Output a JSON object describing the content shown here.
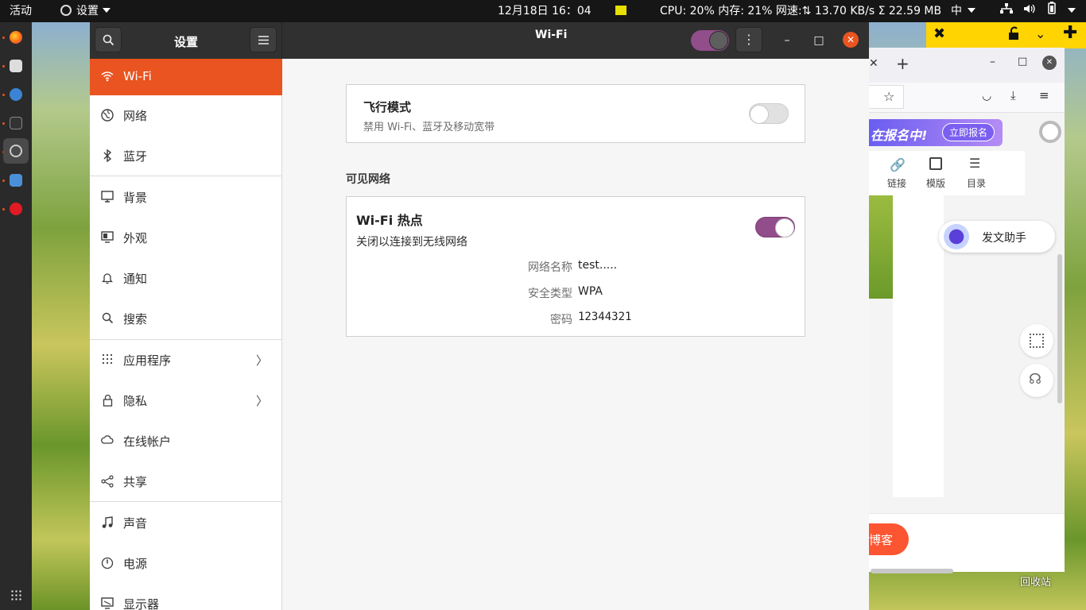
{
  "topbar": {
    "activities": "活动",
    "app_menu": "设置",
    "clock": "12月18日  16：04",
    "sysmon": "CPU: 20% 内存: 21% 网速:⇅ 13.70 KB/s Σ 22.59 MB",
    "input_method": "中"
  },
  "window": {
    "sidebar_title": "设置",
    "page_title": "Wi-Fi",
    "minimize_glyph": "–",
    "maximize_glyph": "□",
    "close_glyph": "✕",
    "menu_glyph": "⋮"
  },
  "sidebar": {
    "items": [
      {
        "label": "Wi-Fi",
        "icon": "wifi-icon"
      },
      {
        "label": "网络",
        "icon": "globe-icon"
      },
      {
        "label": "蓝牙",
        "icon": "bluetooth-icon"
      },
      {
        "label": "背景",
        "icon": "monitor-icon"
      },
      {
        "label": "外观",
        "icon": "appearance-icon"
      },
      {
        "label": "通知",
        "icon": "bell-icon"
      },
      {
        "label": "搜索",
        "icon": "search-icon"
      },
      {
        "label": "应用程序",
        "icon": "grid-icon"
      },
      {
        "label": "隐私",
        "icon": "lock-icon"
      },
      {
        "label": "在线帐户",
        "icon": "cloud-icon"
      },
      {
        "label": "共享",
        "icon": "share-icon"
      },
      {
        "label": "声音",
        "icon": "music-icon"
      },
      {
        "label": "电源",
        "icon": "power-icon"
      },
      {
        "label": "显示器",
        "icon": "display-icon"
      }
    ]
  },
  "airplane": {
    "title": "飞行模式",
    "subtitle": "禁用 Wi-Fi、蓝牙及移动宽带",
    "enabled": false
  },
  "visible_networks_label": "可见网络",
  "hotspot": {
    "title": "Wi-Fi 热点",
    "subtitle": "关闭以连接到无线网络",
    "enabled": true,
    "ssid_label": "网络名称",
    "ssid_value": "test.....",
    "security_label": "安全类型",
    "security_value": "WPA",
    "password_label": "密码",
    "password_value": "12344321"
  },
  "browser": {
    "banner_text": "在报名中!",
    "banner_button": "立即报名",
    "tool_link": "链接",
    "tool_template": "模版",
    "tool_toc": "目录",
    "assistant": "发文助手",
    "blog_button": "博客",
    "trash_label": "回收站"
  },
  "colors": {
    "accent": "#e95420",
    "toggle_on": "#924d8b"
  }
}
